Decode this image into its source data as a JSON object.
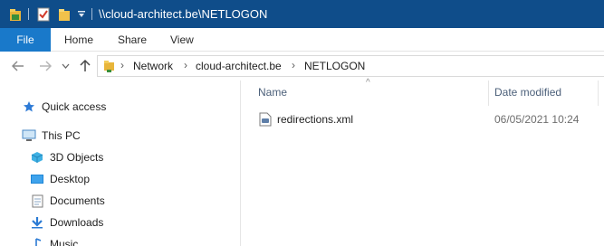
{
  "window": {
    "title": "\\\\cloud-architect.be\\NETLOGON",
    "quick_access_icons": [
      "folder-icon",
      "properties-icon",
      "new-folder-icon",
      "customize-dropdown-icon"
    ],
    "accent_color": "#0f4d8a"
  },
  "ribbon": {
    "file_tab": "File",
    "tabs": [
      "Home",
      "Share",
      "View"
    ],
    "file_tab_color": "#1979ca"
  },
  "navigation": {
    "back_icon": "back-arrow-icon",
    "forward_icon": "forward-arrow-icon",
    "recent_icon": "chevron-down-icon",
    "up_icon": "up-arrow-icon"
  },
  "address": {
    "crumbs": [
      "Network",
      "cloud-architect.be",
      "NETLOGON"
    ]
  },
  "nav_pane": {
    "items": [
      {
        "label": "Quick access",
        "icon": "star-icon"
      },
      {
        "label": "This PC",
        "icon": "computer-icon"
      },
      {
        "label": "3D Objects",
        "icon": "cube-icon"
      },
      {
        "label": "Desktop",
        "icon": "desktop-icon"
      },
      {
        "label": "Documents",
        "icon": "document-icon"
      },
      {
        "label": "Downloads",
        "icon": "download-icon"
      },
      {
        "label": "Music",
        "icon": "music-icon"
      }
    ]
  },
  "file_list": {
    "columns": [
      "Name",
      "Date modified"
    ],
    "sorted_by": "Name",
    "rows": [
      {
        "name": "redirections.xml",
        "date_modified": "06/05/2021 10:24",
        "icon": "xml-file-icon"
      }
    ]
  }
}
